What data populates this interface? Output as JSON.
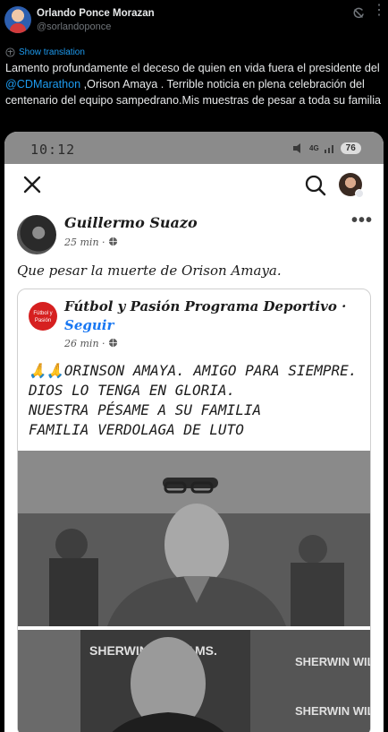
{
  "tweet": {
    "display_name": "Orlando Ponce Morazan",
    "handle": "@sorlandoponce",
    "show_translation": "Show translation",
    "text_before": "Lamento profundamente el deceso de quien en vida fuera el presidente del ",
    "mention": "@CDMarathon",
    "text_after": " ,Orison Amaya . Terrible noticia en plena celebración del centenario del equipo sampedrano.Mis muestras de pesar a toda su familia"
  },
  "phone": {
    "time": "10:12",
    "signal_text": "4G",
    "battery": "76"
  },
  "fb_post": {
    "author": "Guillermo Suazo",
    "time": "25 min ·",
    "text": "Que pesar la muerte de Orison Amaya.",
    "more": "•••"
  },
  "shared_post": {
    "logo_text": "Fútbol y Pasión",
    "page_name": "Fútbol y Pasión  Programa Deportivo ·",
    "follow": "Seguir",
    "time": "26 min ·",
    "lines": [
      "🙏🙏ORINSON AMAYA. AMIGO PARA SIEMPRE.",
      "DIOS LO TENGA EN GLORIA.",
      "NUESTRA PÉSAME A SU FAMILIA",
      "FAMILIA VERDOLAGA DE LUTO"
    ],
    "banner_text": "SHERWIN WILLIAMS."
  }
}
